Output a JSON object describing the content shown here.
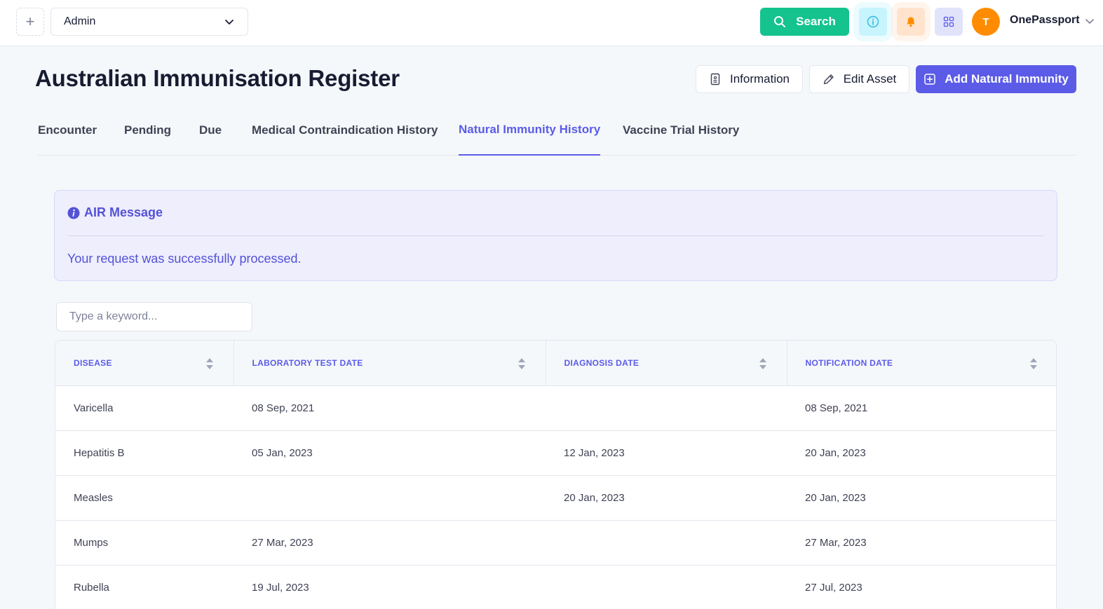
{
  "topbar": {
    "add_icon": "plus-icon",
    "org_select": {
      "value": "Admin"
    },
    "search_label": "Search",
    "icons": [
      "info-icon",
      "bell-icon",
      "grid-icon"
    ],
    "avatar_initial": "T",
    "user_name": "OnePassport",
    "colors": {
      "search": "#14c38e",
      "info": "#c7f4fd",
      "bell": "#ffe3cc",
      "grid": "#e1e3fb",
      "avatar": "#ff8c00"
    }
  },
  "header": {
    "title": "Australian Immunisation Register",
    "information_label": "Information",
    "edit_label": "Edit Asset",
    "add_label": "Add Natural Immunity",
    "accent": "#5b5be8"
  },
  "tabs": [
    {
      "label": "Encounter",
      "active": false
    },
    {
      "label": "Pending",
      "active": false
    },
    {
      "label": "Due",
      "active": false
    },
    {
      "label": "Medical Contraindication History",
      "active": false
    },
    {
      "label": "Natural Immunity History",
      "active": true
    },
    {
      "label": "Vaccine Trial History",
      "active": false
    }
  ],
  "alert": {
    "title": "AIR Message",
    "message": "Your request was successfully processed."
  },
  "search": {
    "placeholder": "Type a keyword..."
  },
  "table": {
    "columns": [
      "DISEASE",
      "LABORATORY TEST DATE",
      "DIAGNOSIS DATE",
      "NOTIFICATION DATE"
    ],
    "rows": [
      [
        "Varicella",
        "08 Sep, 2021",
        "",
        "08 Sep, 2021"
      ],
      [
        "Hepatitis B",
        "05 Jan, 2023",
        "12 Jan, 2023",
        "20 Jan, 2023"
      ],
      [
        "Measles",
        "",
        "20 Jan, 2023",
        "20 Jan, 2023"
      ],
      [
        "Mumps",
        "27 Mar, 2023",
        "",
        "27 Mar, 2023"
      ],
      [
        "Rubella",
        "19 Jul, 2023",
        "",
        "27 Jul, 2023"
      ]
    ]
  }
}
